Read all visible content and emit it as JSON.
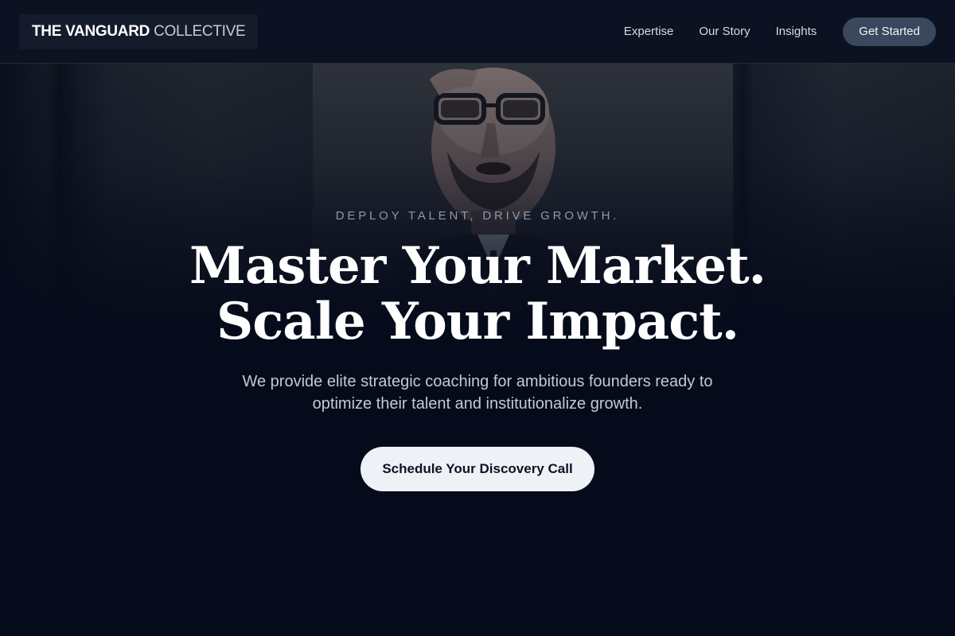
{
  "header": {
    "logo_strong": "THE VANGUARD",
    "logo_light": "COLLECTIVE",
    "nav": [
      "Expertise",
      "Our Story",
      "Insights"
    ],
    "cta_label": "Get Started"
  },
  "hero": {
    "eyebrow": "DEPLOY TALENT, DRIVE GROWTH.",
    "headline_line1": "Master Your Market.",
    "headline_line2": "Scale Your Impact.",
    "subtext": "We provide elite strategic coaching for ambitious founders ready to optimize their talent and institutionalize growth.",
    "cta_label": "Schedule Your Discovery Call"
  },
  "colors": {
    "background": "#060b1b",
    "header_bg": "#0c1221",
    "nav_button_bg": "#39485e",
    "cta_bg": "#eef1f6",
    "cta_text": "#0b1224"
  }
}
